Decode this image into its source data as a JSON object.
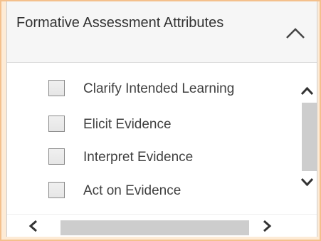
{
  "panel": {
    "title": "Formative Assessment Attributes",
    "collapse_icon": "chevron-up-icon"
  },
  "checklist": {
    "items": [
      {
        "label": "Clarify Intended Learning",
        "checked": false
      },
      {
        "label": "Elicit Evidence",
        "checked": false
      },
      {
        "label": "Interpret Evidence",
        "checked": false
      },
      {
        "label": "Act on Evidence",
        "checked": false
      }
    ]
  },
  "scrollbars": {
    "vertical": {
      "up_icon": "chevron-up-icon",
      "down_icon": "chevron-down-icon"
    },
    "horizontal": {
      "left_icon": "chevron-left-icon",
      "right_icon": "chevron-right-icon"
    }
  },
  "colors": {
    "frame_background": "#fdebd6",
    "frame_border": "#f4c08c",
    "header_background": "#f6f6f6",
    "scroll_thumb": "#cdcdcd",
    "text": "#404040"
  }
}
